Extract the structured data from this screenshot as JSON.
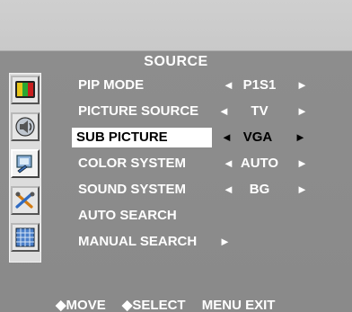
{
  "menu": {
    "title": "SOURCE",
    "rows": [
      {
        "label": "PIP MODE",
        "value": "P1S1",
        "left_arrow": "◄",
        "right_arrow": "►"
      },
      {
        "label": "PICTURE SOURCE",
        "value": "TV",
        "left_arrow": "◄",
        "right_arrow": "►"
      },
      {
        "label": "SUB PICTURE",
        "value": "VGA",
        "left_arrow": "◄",
        "right_arrow": "►"
      },
      {
        "label": "COLOR SYSTEM",
        "value": "AUTO",
        "left_arrow": "◄",
        "right_arrow": "►"
      },
      {
        "label": "SOUND SYSTEM",
        "value": "BG",
        "left_arrow": "◄",
        "right_arrow": "►"
      },
      {
        "label": "AUTO SEARCH"
      },
      {
        "label": "MANUAL SEARCH",
        "right_arrow": "►"
      }
    ],
    "selected_row": "SUB PICTURE"
  },
  "sidebar": {
    "icons": [
      {
        "name": "picture-bars-icon"
      },
      {
        "name": "sound-speaker-icon"
      },
      {
        "name": "source-input-icon",
        "active": true
      },
      {
        "name": "tools-setup-icon"
      },
      {
        "name": "grid-screen-icon"
      }
    ]
  },
  "footer": {
    "move": "◆MOVE",
    "select": "◆SELECT",
    "exit": "MENU EXIT"
  },
  "colors": {
    "panel": "#8a8a8a",
    "top_band": "#cfcfcf",
    "text": "#ffffff",
    "highlight": "#ffffff"
  }
}
